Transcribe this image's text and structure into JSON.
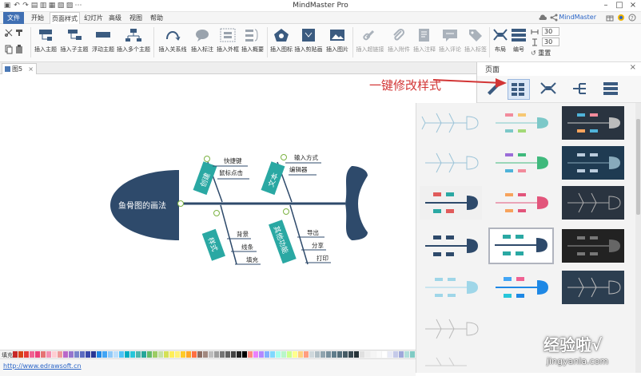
{
  "app": {
    "title": "MindMaster Pro",
    "brand": "MindMaster"
  },
  "menu": {
    "tabs": [
      "文件",
      "开始",
      "页面样式",
      "幻灯片",
      "高级",
      "视图",
      "帮助"
    ]
  },
  "ribbon": {
    "buttons": [
      "插入主题",
      "插入子主题",
      "浮动主题",
      "插入多个主题",
      "插入关系线",
      "插入标注",
      "插入外框",
      "插入概要",
      "插入图标",
      "插入剪贴画",
      "插入图片",
      "插入超链接",
      "插入附件",
      "插入注释",
      "插入评论",
      "插入标签",
      "布局",
      "编号",
      "重置"
    ],
    "spin_values": [
      "30",
      "30"
    ]
  },
  "document": {
    "tab_label": "图5"
  },
  "panel": {
    "title": "页面"
  },
  "annotation": {
    "text": "一键修改样式"
  },
  "fishbone": {
    "head_label": "鱼骨图的画法",
    "branches": [
      {
        "label": "创建",
        "items": [
          "快捷键",
          "鼠标点击"
        ]
      },
      {
        "label": "文本",
        "items": [
          "输入方式",
          "编辑器"
        ]
      },
      {
        "label": "样式",
        "items": [
          "背景",
          "线条",
          "填充"
        ]
      },
      {
        "label": "其他功能",
        "items": [
          "导出",
          "分享",
          "打印"
        ]
      }
    ]
  },
  "colors": {
    "navy": "#2e4a6b",
    "teal": "#2aa8a3",
    "menu_blue": "#3f6fb3",
    "annotation_red": "#d23535",
    "swatches": [
      "#c62828",
      "#d84315",
      "#e53935",
      "#f06292",
      "#ec407a",
      "#e57373",
      "#f48fb1",
      "#ffcdd2",
      "#ef9a9a",
      "#ba68c8",
      "#9575cd",
      "#7986cb",
      "#5c6bc0",
      "#3949ab",
      "#283593",
      "#1e88e5",
      "#42a5f5",
      "#90caf9",
      "#bbdefb",
      "#4fc3f7",
      "#00acc1",
      "#26c6da",
      "#4db6ac",
      "#26a69a",
      "#66bb6a",
      "#9ccc65",
      "#c5e1a5",
      "#d4e157",
      "#ffee58",
      "#fff176",
      "#ffca28",
      "#ffa726",
      "#ff7043",
      "#8d6e63",
      "#a1887f",
      "#bdbdbd",
      "#9e9e9e",
      "#757575",
      "#616161",
      "#424242",
      "#212121",
      "#000000",
      "#ff8a80",
      "#ea80fc",
      "#b388ff",
      "#82b1ff",
      "#80d8ff",
      "#a7ffeb",
      "#b9f6ca",
      "#ccff90",
      "#ffff8d",
      "#ffd180",
      "#ff9e80",
      "#cfd8dc",
      "#b0bec5",
      "#90a4ae",
      "#78909c",
      "#607d8b",
      "#546e7a",
      "#455a64",
      "#37474f",
      "#263238",
      "#e0e0e0",
      "#eeeeee",
      "#f5f5f5",
      "#fafafa",
      "#ffffff",
      "#e8eaf6",
      "#c5cae9",
      "#9fa8da",
      "#b2dfdb",
      "#80cbc4"
    ]
  },
  "colorbar": {
    "fill_label": "填充"
  },
  "status": {
    "link": "http://www.edrawsoft.cn"
  },
  "watermark": {
    "text": "经验啦√",
    "url": "jingyanla.com"
  }
}
